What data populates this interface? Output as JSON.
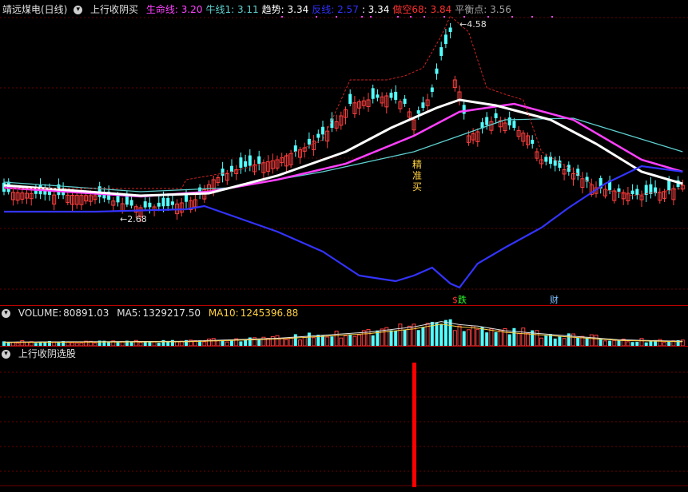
{
  "main_header": {
    "title": "靖远煤电(日线)",
    "indicator": "上行收阴买",
    "items": [
      {
        "label": "生命线:",
        "value": "3.20",
        "color": "#ff40ff"
      },
      {
        "label": "牛线1:",
        "value": "3.11",
        "color": "#5fd0d0"
      },
      {
        "label": "趋势:",
        "value": "3.34",
        "color": "#ffffff"
      },
      {
        "label": "反线:",
        "value": "2.57",
        "color": "#3030ff"
      },
      {
        "label": ":",
        "value": "3.34",
        "color": "#ffffff"
      },
      {
        "label": "做空68:",
        "value": "3.84",
        "color": "#ff3030"
      },
      {
        "label": "平衡点:",
        "value": "3.56",
        "color": "#a0a0a0"
      }
    ]
  },
  "annotations": {
    "high_label": "4.58",
    "low_label": "←2.68",
    "buy_chars": [
      "精",
      "准",
      "买"
    ],
    "sell_char": "跌",
    "sell_prefix": "$",
    "finance_char": "财"
  },
  "volume_header": {
    "label": "VOLUME:",
    "value": "80891.03",
    "ma5_label": "MA5:",
    "ma5_value": "1329217.50",
    "ma10_label": "MA10:",
    "ma10_value": "1245396.88"
  },
  "signal_header": {
    "label": "上行收阴选股"
  },
  "colors": {
    "up": "#ff4040",
    "down": "#54ffff",
    "lifeline": "#ff40ff",
    "bull": "#5fd0d0",
    "trend": "#ffffff",
    "reverse": "#3333ff",
    "short": "#cc2222",
    "signal": "#ff0000"
  },
  "chart_data": {
    "type": "candlestick",
    "price_labels": {
      "high": 4.58,
      "low": 2.68
    },
    "indicator_values": {
      "lifeline": 3.2,
      "bull1": 3.11,
      "trend": 3.34,
      "reverse": 2.57,
      "short68": 3.84,
      "balance": 3.56
    },
    "volume": {
      "value": 80891.03,
      "ma5": 1329217.5,
      "ma10": 1245396.88
    },
    "signal_bars": 1
  }
}
